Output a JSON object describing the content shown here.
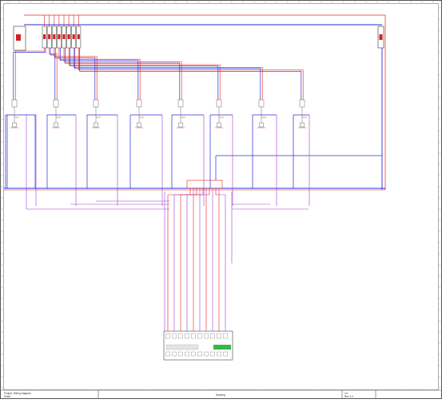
{
  "colors": {
    "phase": "#e8231c",
    "neutral": "#2a2bd8",
    "control": "#a23bd8",
    "frame": "#555555",
    "device_green": "#39b54a",
    "breaker_red": "#d81e1e"
  },
  "sheet": {
    "main_breaker_label": "",
    "branch_count": 8,
    "title_block": {
      "left_line_1": "Project: Wiring Diagram",
      "left_line_2": "Sheet",
      "center": "Drawing",
      "right_line_1": "1/1",
      "right_line_2": "Rev 1.0"
    }
  },
  "controller": {
    "name": "",
    "terminal_count": 10
  }
}
